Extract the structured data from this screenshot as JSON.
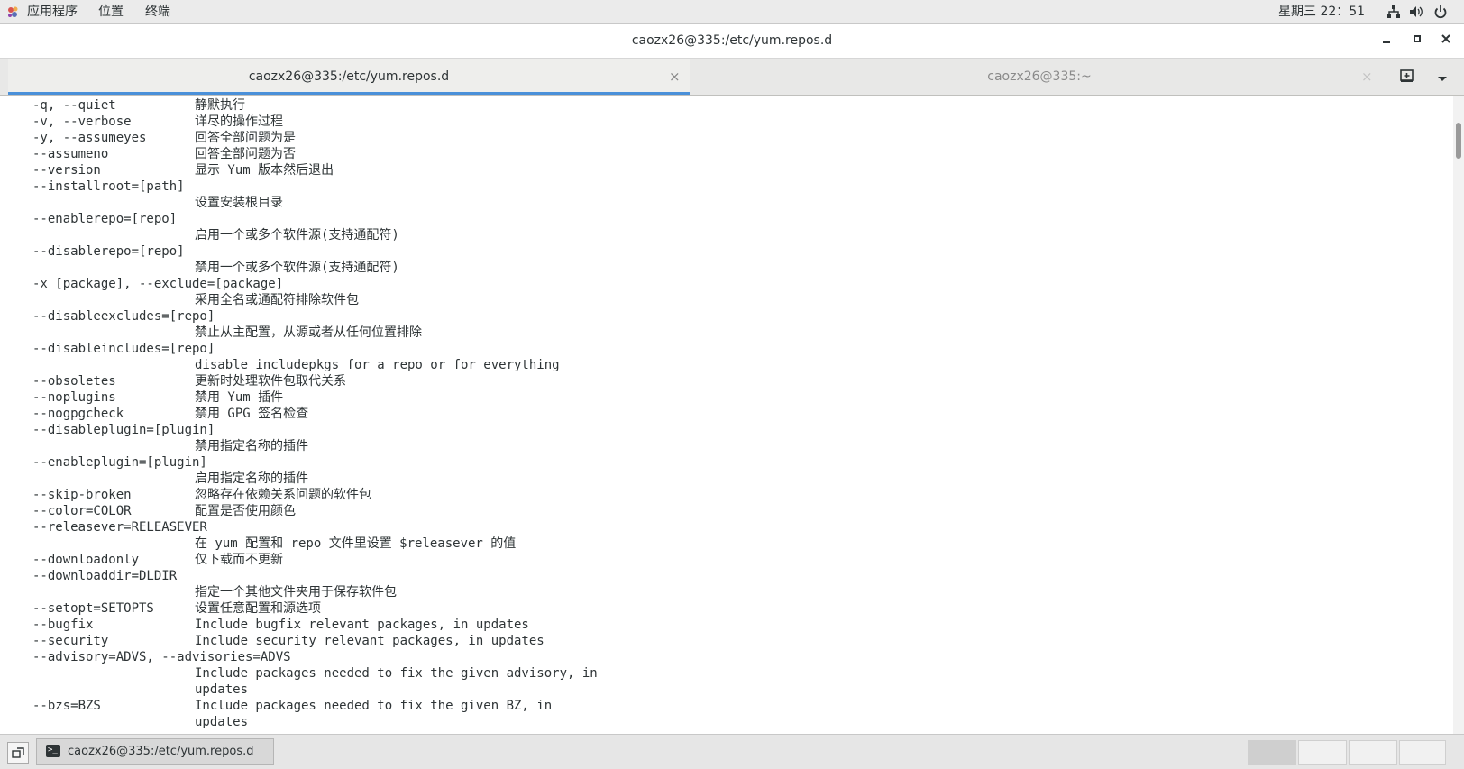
{
  "topbar": {
    "menu": [
      "应用程序",
      "位置",
      "终端"
    ],
    "clock": "星期三 22：51",
    "tray_icons": [
      "network-icon",
      "volume-icon",
      "power-icon"
    ]
  },
  "window": {
    "title": "caozx26@335:/etc/yum.repos.d"
  },
  "tabs": [
    {
      "label": "caozx26@335:/etc/yum.repos.d",
      "active": true
    },
    {
      "label": "caozx26@335:~",
      "active": false
    }
  ],
  "terminal_lines": [
    {
      "opt": "-q, --quiet",
      "desc": "静默执行"
    },
    {
      "opt": "-v, --verbose",
      "desc": "详尽的操作过程"
    },
    {
      "opt": "-y, --assumeyes",
      "desc": "回答全部问题为是"
    },
    {
      "opt": "--assumeno",
      "desc": "回答全部问题为否"
    },
    {
      "opt": "--version",
      "desc": "显示 Yum 版本然后退出"
    },
    {
      "opt": "--installroot=[path]",
      "desc": ""
    },
    {
      "opt": "",
      "desc": "设置安装根目录"
    },
    {
      "opt": "--enablerepo=[repo]",
      "desc": ""
    },
    {
      "opt": "",
      "desc": "启用一个或多个软件源(支持通配符)"
    },
    {
      "opt": "--disablerepo=[repo]",
      "desc": ""
    },
    {
      "opt": "",
      "desc": "禁用一个或多个软件源(支持通配符)"
    },
    {
      "opt": "-x [package], --exclude=[package]",
      "desc": ""
    },
    {
      "opt": "",
      "desc": "采用全名或通配符排除软件包"
    },
    {
      "opt": "--disableexcludes=[repo]",
      "desc": ""
    },
    {
      "opt": "",
      "desc": "禁止从主配置，从源或者从任何位置排除"
    },
    {
      "opt": "--disableincludes=[repo]",
      "desc": ""
    },
    {
      "opt": "",
      "desc": "disable includepkgs for a repo or for everything"
    },
    {
      "opt": "--obsoletes",
      "desc": "更新时处理软件包取代关系"
    },
    {
      "opt": "--noplugins",
      "desc": "禁用 Yum 插件"
    },
    {
      "opt": "--nogpgcheck",
      "desc": "禁用 GPG 签名检查"
    },
    {
      "opt": "--disableplugin=[plugin]",
      "desc": ""
    },
    {
      "opt": "",
      "desc": "禁用指定名称的插件"
    },
    {
      "opt": "--enableplugin=[plugin]",
      "desc": ""
    },
    {
      "opt": "",
      "desc": "启用指定名称的插件"
    },
    {
      "opt": "--skip-broken",
      "desc": "忽略存在依赖关系问题的软件包"
    },
    {
      "opt": "--color=COLOR",
      "desc": "配置是否使用颜色"
    },
    {
      "opt": "--releasever=RELEASEVER",
      "desc": ""
    },
    {
      "opt": "",
      "desc": "在 yum 配置和 repo 文件里设置 $releasever 的值"
    },
    {
      "opt": "--downloadonly",
      "desc": "仅下载而不更新"
    },
    {
      "opt": "--downloaddir=DLDIR",
      "desc": ""
    },
    {
      "opt": "",
      "desc": "指定一个其他文件夹用于保存软件包"
    },
    {
      "opt": "--setopt=SETOPTS",
      "desc": "设置任意配置和源选项"
    },
    {
      "opt": "--bugfix",
      "desc": "Include bugfix relevant packages, in updates"
    },
    {
      "opt": "--security",
      "desc": "Include security relevant packages, in updates"
    },
    {
      "opt": "--advisory=ADVS, --advisories=ADVS",
      "desc": ""
    },
    {
      "opt": "",
      "desc": "Include packages needed to fix the given advisory, in"
    },
    {
      "opt": "",
      "desc": "updates"
    },
    {
      "opt": "--bzs=BZS",
      "desc": "Include packages needed to fix the given BZ, in"
    },
    {
      "opt": "",
      "desc": "updates"
    }
  ],
  "taskbar": {
    "window_label": "caozx26@335:/etc/yum.repos.d",
    "workspaces": 4,
    "current_workspace": 1
  },
  "colors": {
    "tab_accent": "#4a90d9",
    "panel_bg": "#ebebeb",
    "terminal_bg": "#ffffff",
    "terminal_fg": "#2e3436"
  }
}
